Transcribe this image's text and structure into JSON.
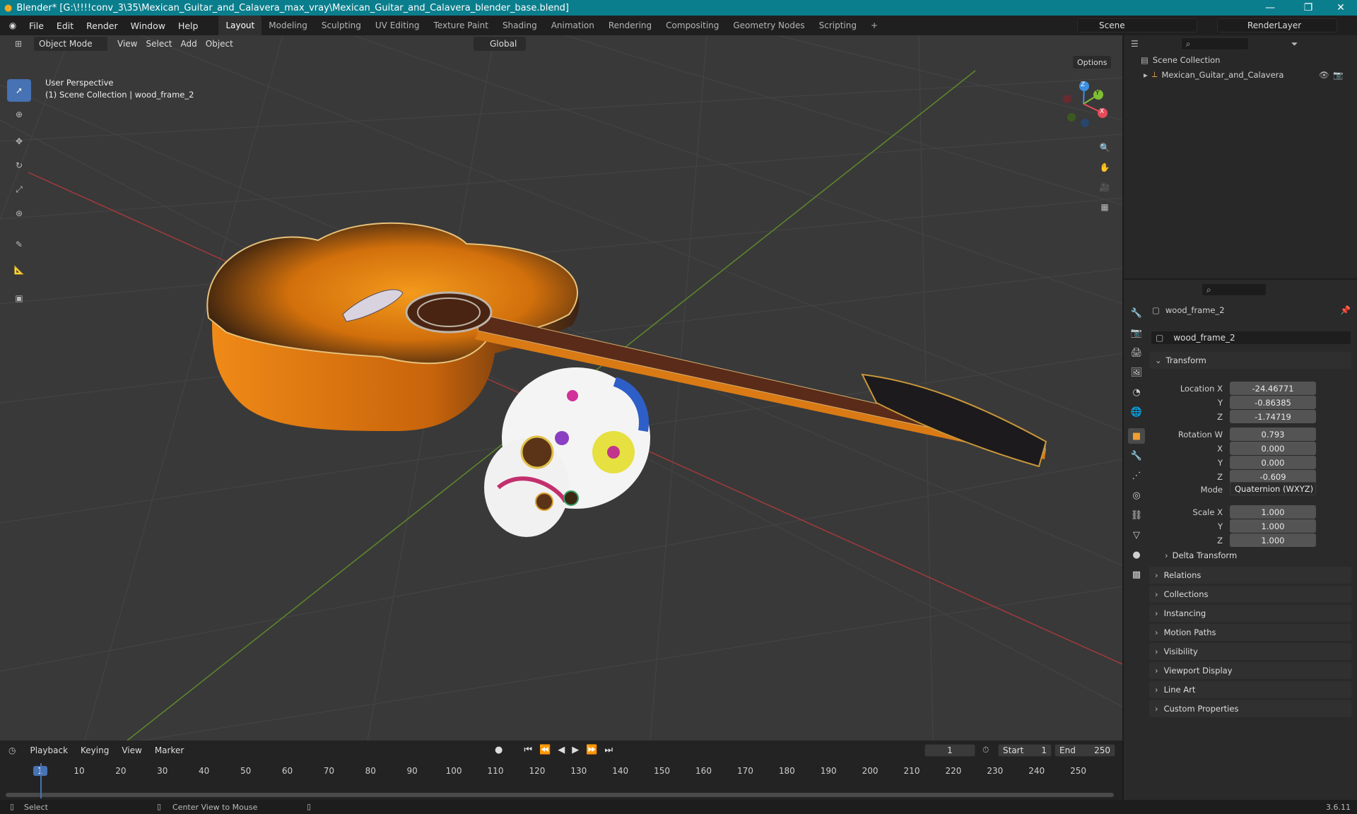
{
  "window": {
    "title": "Blender* [G:\\!!!!conv_3\\35\\Mexican_Guitar_and_Calavera_max_vray\\Mexican_Guitar_and_Calavera_blender_base.blend]",
    "minimize": "—",
    "restore": "❐",
    "close": "✕"
  },
  "menus": [
    "File",
    "Edit",
    "Render",
    "Window",
    "Help"
  ],
  "workspaces": [
    "Layout",
    "Modeling",
    "Sculpting",
    "UV Editing",
    "Texture Paint",
    "Shading",
    "Animation",
    "Rendering",
    "Compositing",
    "Geometry Nodes",
    "Scripting"
  ],
  "add_workspace": "+",
  "scene": "Scene",
  "render_layer": "RenderLayer",
  "viewport_header": {
    "mode": "Object Mode",
    "menus": [
      "View",
      "Select",
      "Add",
      "Object"
    ],
    "transform": "Global",
    "options": "Options"
  },
  "viewport_overlay": {
    "perspective": "User Perspective",
    "collection": "(1) Scene Collection | wood_frame_2"
  },
  "gizmo": {
    "x": "X",
    "y": "Y",
    "z": "Z"
  },
  "outliner": {
    "root": "Scene Collection",
    "item": "Mexican_Guitar_and_Calavera"
  },
  "properties": {
    "object_name": "wood_frame_2",
    "data_name": "wood_frame_2",
    "transform_label": "Transform",
    "location_label": "Location X",
    "location": [
      "-24.46771",
      "-0.86385",
      "-1.74719"
    ],
    "rotation_label": "Rotation W",
    "rotation": [
      "0.793",
      "0.000",
      "0.000",
      "-0.609"
    ],
    "axis_x": "X",
    "axis_y": "Y",
    "axis_z": "Z",
    "mode_label": "Mode",
    "mode": "Quaternion (WXYZ)",
    "scale_label": "Scale X",
    "scale": [
      "1.000",
      "1.000",
      "1.000"
    ],
    "delta": "Delta Transform",
    "panels": [
      "Relations",
      "Collections",
      "Instancing",
      "Motion Paths",
      "Visibility",
      "Viewport Display",
      "Line Art",
      "Custom Properties"
    ]
  },
  "timeline": {
    "menus": [
      "Playback",
      "Keying",
      "View",
      "Marker"
    ],
    "current": "1",
    "start_label": "Start",
    "start": "1",
    "end_label": "End",
    "end": "250",
    "ticks": [
      "1",
      "10",
      "20",
      "30",
      "40",
      "50",
      "60",
      "70",
      "80",
      "90",
      "100",
      "110",
      "120",
      "130",
      "140",
      "150",
      "160",
      "170",
      "180",
      "190",
      "200",
      "210",
      "220",
      "230",
      "240",
      "250"
    ]
  },
  "status": {
    "select": "Select",
    "center": "Center View to Mouse",
    "version": "3.6.11"
  },
  "colors": {
    "accent": "#4772b3",
    "titlebar": "#0a7e8c",
    "axis_x": "#e84b5a",
    "axis_y": "#7fbf34",
    "axis_z": "#3d8de0"
  }
}
